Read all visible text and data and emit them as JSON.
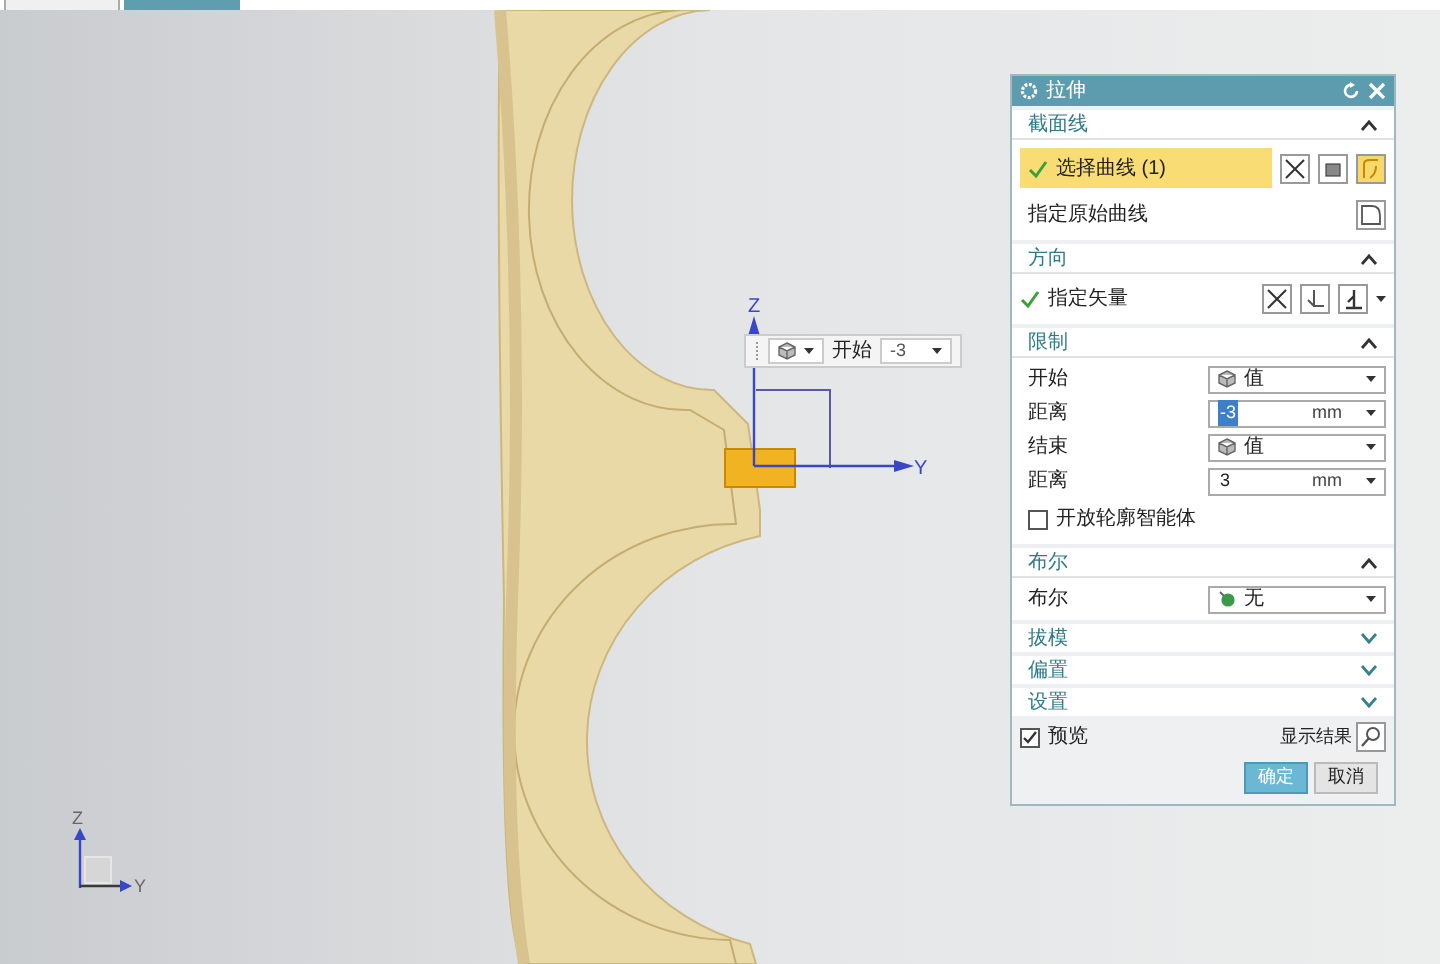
{
  "tabs": [
    {
      "selected": false
    },
    {
      "selected": true
    }
  ],
  "triad": {
    "z": "Z",
    "y": "Y"
  },
  "small_triad": {
    "z": "Z",
    "y": "Y"
  },
  "floating_toolbar": {
    "label": "开始",
    "value": "-3"
  },
  "dialog": {
    "title": "拉伸",
    "sections": [
      {
        "title": "截面线",
        "expanded": true,
        "rows": [
          {
            "kind": "select",
            "label": "选择曲线 (1)",
            "checked": true,
            "selected": true
          },
          {
            "kind": "specify",
            "label": "指定原始曲线"
          }
        ]
      },
      {
        "title": "方向",
        "expanded": true,
        "rows": [
          {
            "kind": "vector",
            "label": "指定矢量",
            "checked": true
          }
        ]
      },
      {
        "title": "限制",
        "expanded": true,
        "rows": [
          {
            "kind": "dropdown",
            "label": "开始",
            "value": "值"
          },
          {
            "kind": "distance",
            "label": "距离",
            "value": "-3",
            "unit": "mm",
            "selected": true
          },
          {
            "kind": "dropdown",
            "label": "结束",
            "value": "值"
          },
          {
            "kind": "distance",
            "label": "距离",
            "value": "3",
            "unit": "mm",
            "selected": false
          },
          {
            "kind": "checkbox",
            "label": "开放轮廓智能体",
            "checked": false
          }
        ]
      },
      {
        "title": "布尔",
        "expanded": true,
        "rows": [
          {
            "kind": "boolean",
            "label": "布尔",
            "value": "无"
          }
        ]
      },
      {
        "title": "拔模",
        "expanded": false
      },
      {
        "title": "偏置",
        "expanded": false
      },
      {
        "title": "设置",
        "expanded": false
      }
    ],
    "preview": {
      "label": "预览",
      "checked": true
    },
    "show_result": "显示结果",
    "buttons": [
      {
        "label": "确定",
        "primary": true
      },
      {
        "label": "取消",
        "primary": false
      }
    ]
  }
}
